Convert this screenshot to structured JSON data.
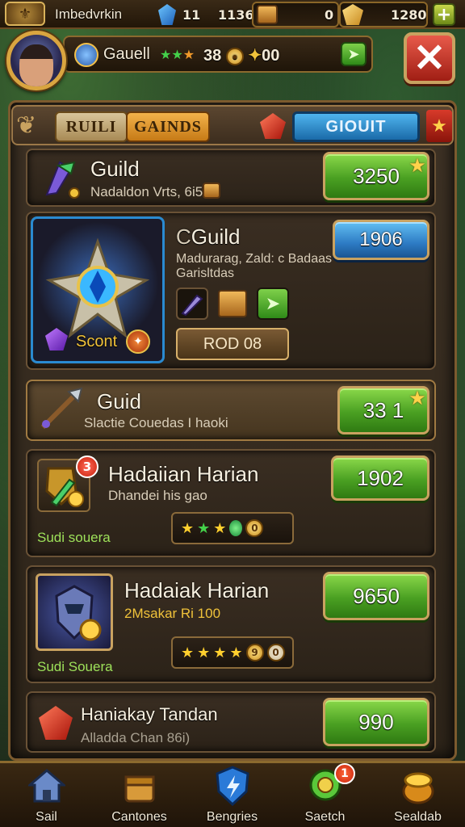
{
  "topbar": {
    "player_title": "Imbedvrkin",
    "gems": "11",
    "energy": "1136",
    "chest_count": "0",
    "gold": "1280",
    "plus_label": "+"
  },
  "profile": {
    "name": "Gauell",
    "stars": "★★★",
    "level": "38",
    "currency": "00"
  },
  "close_label": "✕",
  "tabs": [
    {
      "label": "RUILI"
    },
    {
      "label": "GAINDS"
    },
    {
      "label": "GIOUIT"
    }
  ],
  "cards": [
    {
      "title": "Guild",
      "subtitle": "Nadaldon Vrts, 6i5b",
      "price": "3250"
    },
    {
      "title": "Guild",
      "title_prefix": "C",
      "subtitle_line1": "Madurarag, Zald: c Badaas",
      "subtitle_line2": "Garisltdas",
      "price": "1906",
      "badge_label": "Scont",
      "action_label": "ROD 08"
    },
    {
      "title": "Guid",
      "subtitle": "Slactie Couedas I haoki",
      "price": "33 1"
    },
    {
      "title": "Hadaiian Harian",
      "subtitle": "Dhandei his gao",
      "tag": "Sudi souera",
      "notif": "3",
      "price": "1902",
      "rating_coin": "0"
    },
    {
      "title": "Hadaiak Harian",
      "subtitle": "2Msakar Ri 100",
      "tag": "Sudi Souera",
      "price": "9650",
      "rating_coin_1": "9",
      "rating_coin_2": "0"
    },
    {
      "title": "Haniakay Tandan",
      "subtitle": "Alladda Chan 86i)",
      "price": "990"
    }
  ],
  "bottom_nav": [
    {
      "label": "Sail",
      "icon": "house-icon"
    },
    {
      "label": "Cantones",
      "icon": "chest-icon"
    },
    {
      "label": "Bengries",
      "icon": "shield-icon"
    },
    {
      "label": "Saetch",
      "icon": "chat-icon",
      "badge": "1"
    },
    {
      "label": "Sealdab",
      "icon": "gold-pot-icon"
    }
  ]
}
